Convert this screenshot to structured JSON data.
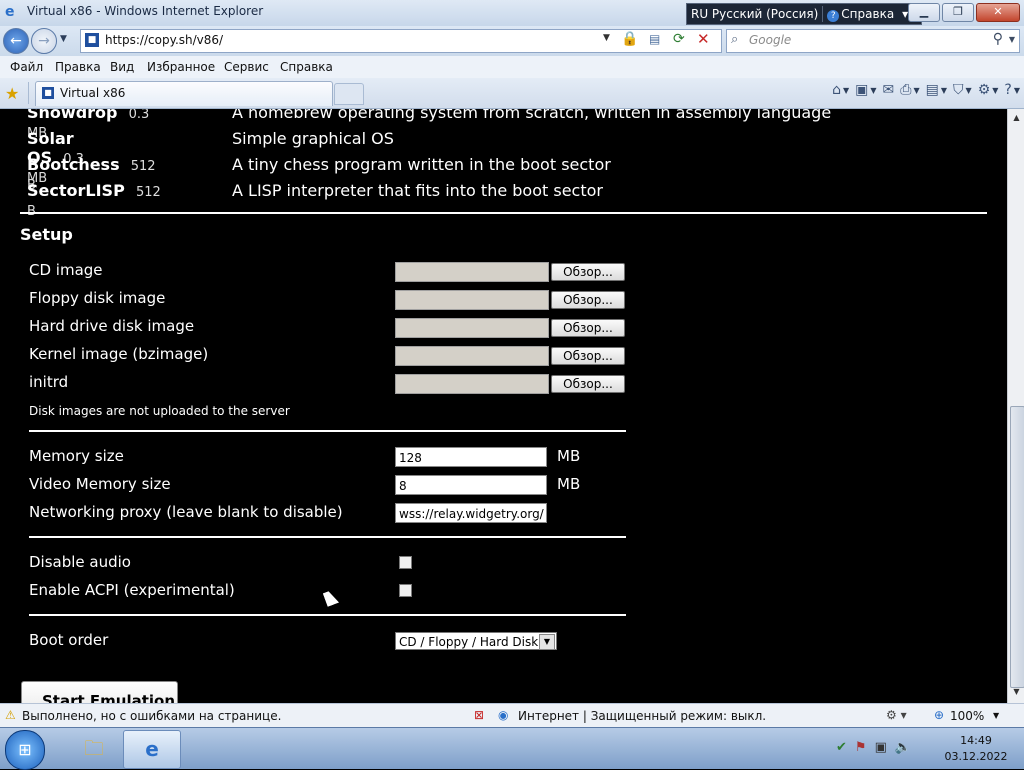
{
  "window": {
    "title": "Virtual x86 - Windows Internet Explorer",
    "language": "RU Русский (Россия)",
    "help": "Справка"
  },
  "address": {
    "url": "https://copy.sh/v86/",
    "search_placeholder": "Google"
  },
  "menu": [
    "Файл",
    "Правка",
    "Вид",
    "Избранное",
    "Сервис",
    "Справка"
  ],
  "tab": {
    "label": "Virtual x86"
  },
  "os_list": [
    {
      "name": "Snowdrop",
      "size": "0.3 MB",
      "desc": "A homebrew operating system from scratch, written in assembly language"
    },
    {
      "name": "Solar OS",
      "size": "0.3 MB",
      "desc": "Simple graphical OS"
    },
    {
      "name": "Bootchess",
      "size": "512 B",
      "desc": "A tiny chess program written in the boot sector"
    },
    {
      "name": "SectorLISP",
      "size": "512 B",
      "desc": "A LISP interpreter that fits into the boot sector"
    }
  ],
  "setup": {
    "heading": "Setup",
    "browse_label": "Обзор...",
    "files": [
      "CD image",
      "Floppy disk image",
      "Hard drive disk image",
      "Kernel image (bzimage)",
      "initrd"
    ],
    "note": "Disk images are not uploaded to the server",
    "memory_label": "Memory size",
    "memory_value": "128",
    "video_memory_label": "Video Memory size",
    "video_memory_value": "8",
    "unit": "MB",
    "proxy_label": "Networking proxy (leave blank to disable)",
    "proxy_value": "wss://relay.widgetry.org/",
    "disable_audio_label": "Disable audio",
    "acpi_label": "Enable ACPI (experimental)",
    "boot_order_label": "Boot order",
    "boot_order_value": "CD / Floppy / Hard Disk",
    "start_button": "Start Emulation"
  },
  "status": {
    "message": "Выполнено, но с ошибками на странице.",
    "zone": "Интернет | Защищенный режим: выкл.",
    "zoom": "100%"
  },
  "taskbar": {
    "time": "14:49",
    "date": "03.12.2022"
  }
}
